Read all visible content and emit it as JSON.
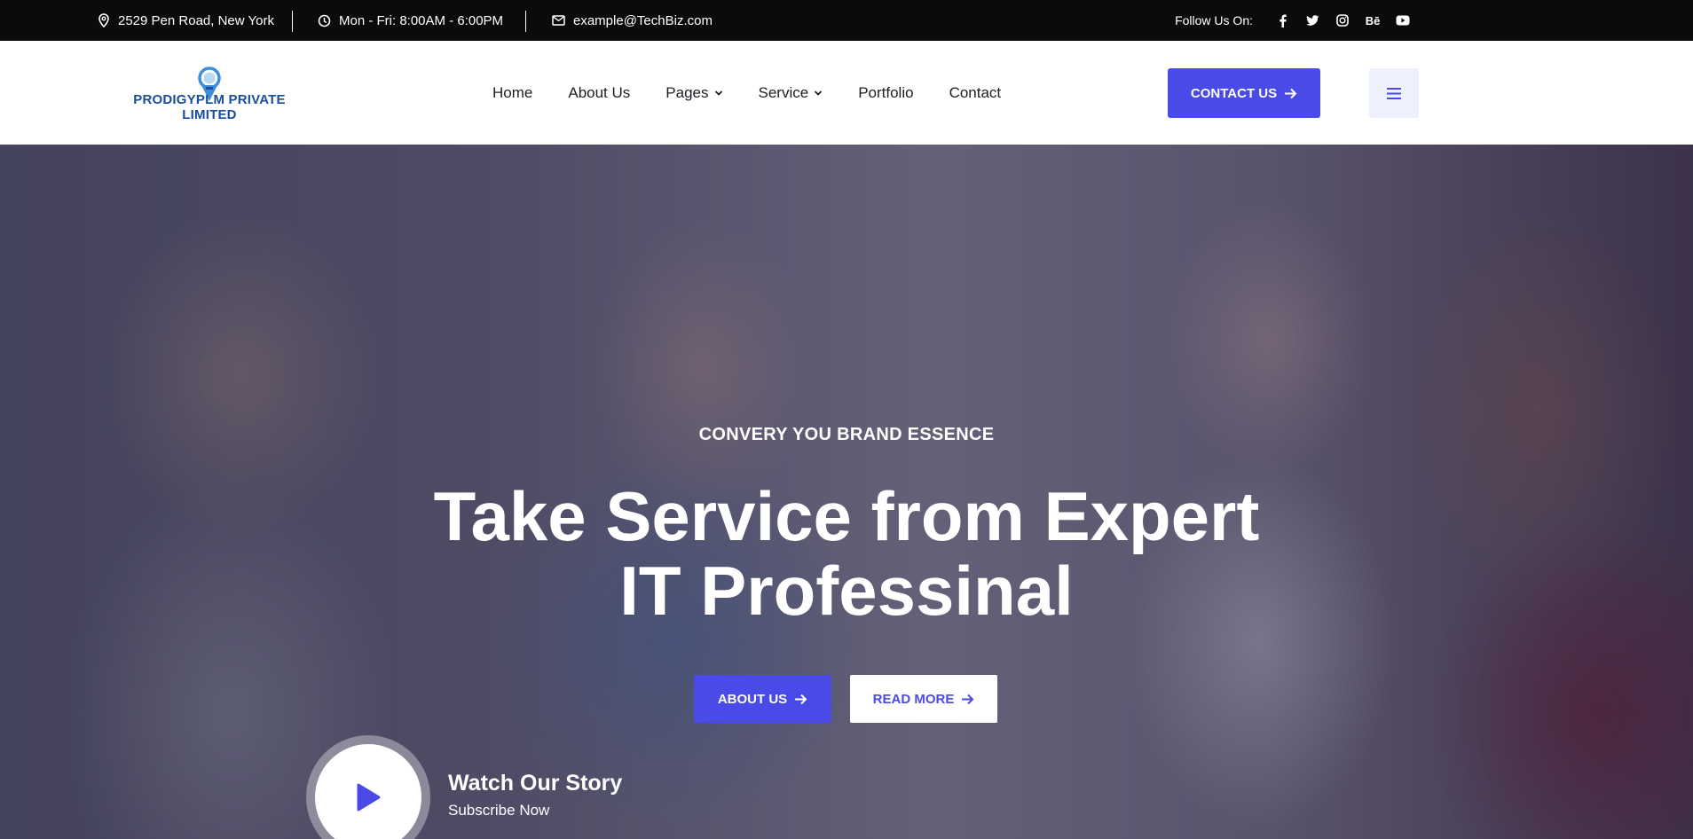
{
  "topbar": {
    "address": "2529 Pen Road, New York",
    "hours": "Mon - Fri: 8:00AM - 6:00PM",
    "email": "example@TechBiz.com",
    "follow_label": "Follow Us On:",
    "socials": [
      {
        "icon": "facebook-icon",
        "glyph": "f"
      },
      {
        "icon": "twitter-icon",
        "glyph": "t"
      },
      {
        "icon": "instagram-icon",
        "glyph": "ig"
      },
      {
        "icon": "behance-icon",
        "glyph": "Bē"
      },
      {
        "icon": "youtube-icon",
        "glyph": "▶"
      }
    ]
  },
  "header": {
    "logo_text": "PRODIGYPLM PRIVATE LIMITED",
    "nav": [
      {
        "label": "Home",
        "dropdown": false
      },
      {
        "label": "About Us",
        "dropdown": false
      },
      {
        "label": "Pages",
        "dropdown": true
      },
      {
        "label": "Service",
        "dropdown": true
      },
      {
        "label": "Portfolio",
        "dropdown": false
      },
      {
        "label": "Contact",
        "dropdown": false
      }
    ],
    "contact_button": "CONTACT US"
  },
  "hero": {
    "tagline": "CONVERY YOU BRAND ESSENCE",
    "title_line1": "Take Service from Expert",
    "title_line2": "IT Professinal",
    "about_button": "ABOUT US",
    "read_button": "READ MORE",
    "watch_title": "Watch Our Story",
    "watch_subtitle": "Subscribe Now"
  },
  "colors": {
    "accent": "#4a4ae8",
    "topbar_bg": "#0b0b0d",
    "logo_blue": "#1a4d9c"
  }
}
